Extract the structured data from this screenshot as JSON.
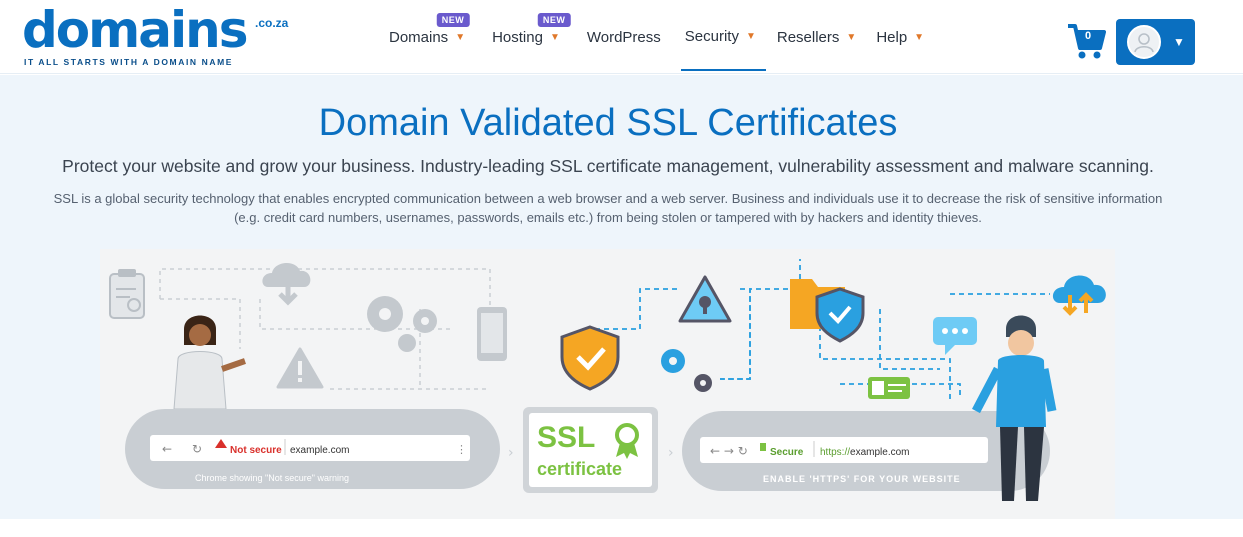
{
  "brand": {
    "name": "domains",
    "tld": ".co.za",
    "tagline": "IT ALL STARTS WITH A DOMAIN NAME",
    "color": "#0a6fc0"
  },
  "nav": {
    "items": [
      {
        "label": "Domains",
        "badge": "NEW",
        "has_dropdown": true
      },
      {
        "label": "Hosting",
        "badge": "NEW",
        "has_dropdown": true
      },
      {
        "label": "WordPress",
        "has_dropdown": false
      },
      {
        "label": "Security",
        "has_dropdown": true,
        "active": true
      },
      {
        "label": "Resellers",
        "has_dropdown": true
      },
      {
        "label": "Help",
        "has_dropdown": true
      }
    ]
  },
  "cart": {
    "count": "0",
    "icon": "cart-icon"
  },
  "account": {
    "icon": "user-avatar-icon"
  },
  "hero": {
    "title": "Domain Validated SSL Certificates",
    "lead": "Protect your website and grow your business. Industry-leading SSL certificate management, vulnerability assessment and malware scanning.",
    "description": "SSL is a global security technology that enables encrypted communication between a web browser and a web server. Business and individuals use it to decrease the risk of sensitive information (e.g. credit card numbers, usernames, passwords, emails etc.) from being stolen or tampered with by hackers and identity thieves."
  },
  "illustration": {
    "left_bar": {
      "status": "Not secure",
      "url": "example.com",
      "caption": "Chrome showing \"Not secure\" warning"
    },
    "badge": {
      "line1": "SSL",
      "line2": "certificate"
    },
    "right_bar": {
      "status": "Secure",
      "url": "https://example.com",
      "url_scheme": "https://",
      "url_host": "example.com",
      "caption": "ENABLE 'HTTPS' FOR YOUR WEBSITE"
    },
    "colors": {
      "accent_blue": "#0a6fc0",
      "ssl_green": "#7cc242",
      "warning_red": "#d9302b",
      "shield_orange": "#f5a623"
    }
  }
}
